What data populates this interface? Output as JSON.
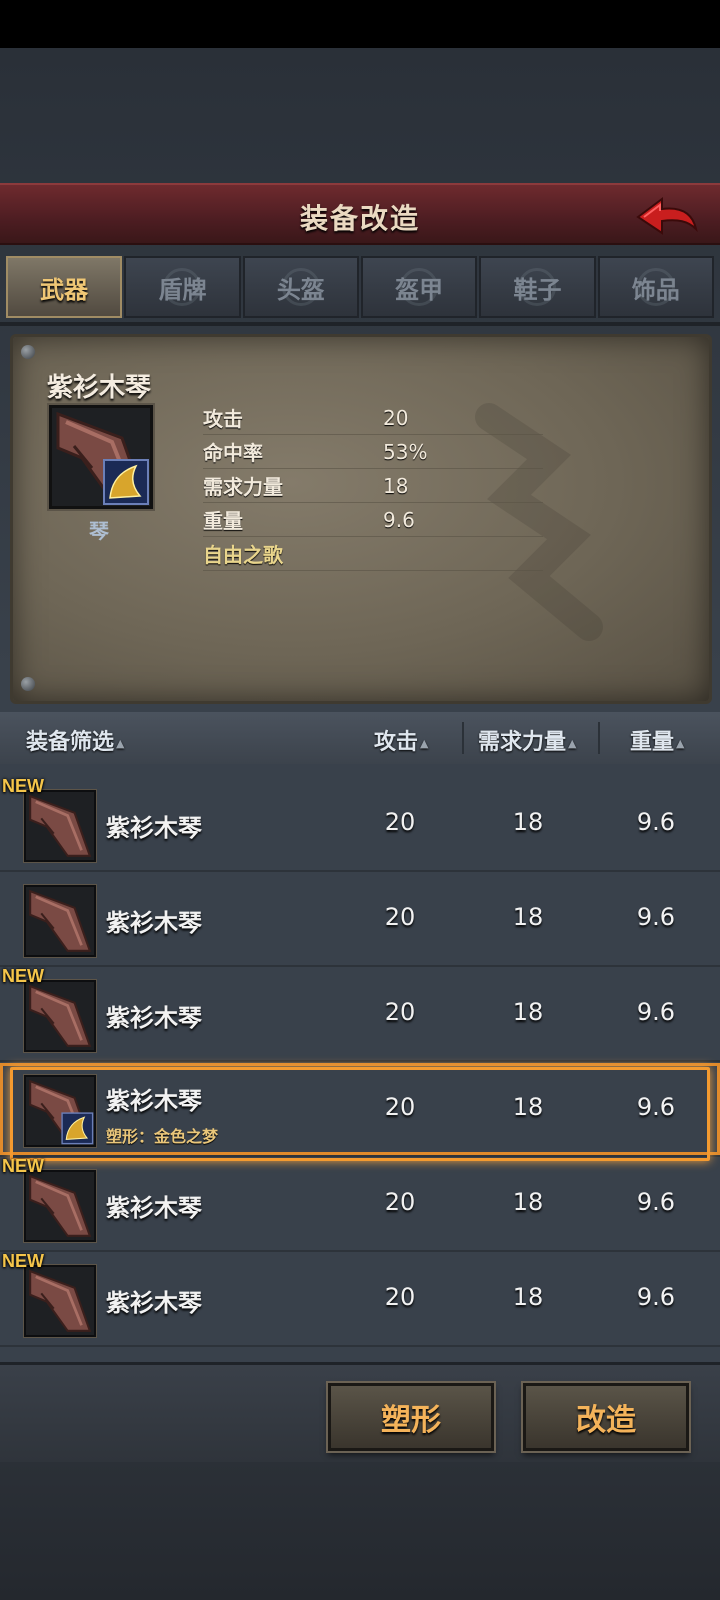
{
  "header": {
    "title": "装备改造"
  },
  "tabs": [
    {
      "label": "武器",
      "active": true
    },
    {
      "label": "盾牌",
      "active": false
    },
    {
      "label": "头盔",
      "active": false
    },
    {
      "label": "盔甲",
      "active": false
    },
    {
      "label": "鞋子",
      "active": false
    },
    {
      "label": "饰品",
      "active": false
    }
  ],
  "detail": {
    "name": "紫衫木琴",
    "type": "琴",
    "stats": [
      {
        "label": "攻击",
        "value": "20"
      },
      {
        "label": "命中率",
        "value": "53%"
      },
      {
        "label": "需求力量",
        "value": "18"
      },
      {
        "label": "重量",
        "value": "9.6"
      }
    ],
    "skill": "自由之歌"
  },
  "list_header": {
    "filter": "装备筛选",
    "attack": "攻击",
    "strength": "需求力量",
    "weight": "重量"
  },
  "rows": [
    {
      "name": "紫衫木琴",
      "attack": "20",
      "strength": "18",
      "weight": "9.6",
      "new": "NEW",
      "sub": ""
    },
    {
      "name": "紫衫木琴",
      "attack": "20",
      "strength": "18",
      "weight": "9.6",
      "new": "",
      "sub": ""
    },
    {
      "name": "紫衫木琴",
      "attack": "20",
      "strength": "18",
      "weight": "9.6",
      "new": "NEW",
      "sub": ""
    },
    {
      "name": "紫衫木琴",
      "attack": "20",
      "strength": "18",
      "weight": "9.6",
      "new": "",
      "sub": "塑形：金色之梦",
      "selected": true
    },
    {
      "name": "紫衫木琴",
      "attack": "20",
      "strength": "18",
      "weight": "9.6",
      "new": "NEW",
      "sub": ""
    },
    {
      "name": "紫衫木琴",
      "attack": "20",
      "strength": "18",
      "weight": "9.6",
      "new": "NEW",
      "sub": ""
    }
  ],
  "buttons": {
    "reshape": "塑形",
    "modify": "改造"
  },
  "colors": {
    "accent": "#f0c775",
    "selected_border": "#f39a30",
    "header_bg": "#5a2226",
    "button_text": "#f4b35a"
  }
}
